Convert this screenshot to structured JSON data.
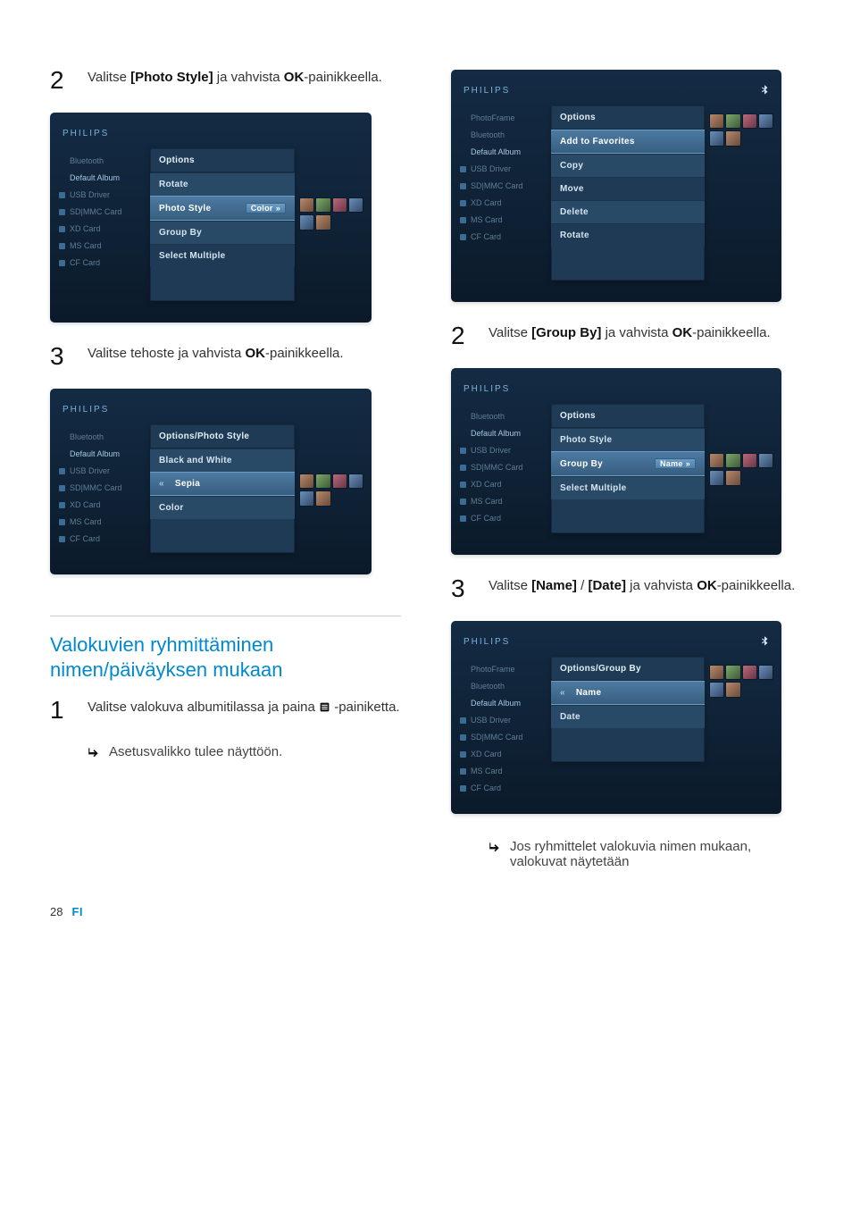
{
  "footer": {
    "page_number": "28",
    "locale": "FI"
  },
  "heading": "Valokuvien ryhmittäminen nimen/päiväyksen mukaan",
  "left": {
    "step2_a": "Valitse ",
    "step2_b": "[Photo Style]",
    "step2_c": " ja vahvista ",
    "step2_d": "OK",
    "step2_e": "-painikkeella.",
    "step3_a": "Valitse tehoste ja vahvista ",
    "step3_b": "OK",
    "step3_c": "-painikkeella.",
    "step1_a": "Valitse valokuva albumitilassa ja paina ",
    "step1_b": " -painiketta.",
    "bullet1": "Asetusvalikko tulee näyttöön."
  },
  "right": {
    "step2_a": "Valitse ",
    "step2_b": "[Group By]",
    "step2_c": " ja vahvista ",
    "step2_d": "OK",
    "step2_e": "-painikkeella.",
    "step3_a": "Valitse ",
    "step3_b": "[Name]",
    "step3_c": " / ",
    "step3_d": "[Date]",
    "step3_e": " ja vahvista ",
    "step3_f": "OK",
    "step3_g": "-painikkeella.",
    "bullet1": "Jos ryhmittelet valokuvia nimen mukaan, valokuvat näytetään"
  },
  "ss_common": {
    "logo": "PHILIPS",
    "sidebar": [
      "PhotoFrame",
      "Bluetooth",
      "Default Album",
      "USB Driver",
      "SD|MMC Card",
      "XD Card",
      "MS Card",
      "CF Card"
    ]
  },
  "ss1_left": {
    "title": "Options",
    "rows": [
      "Rotate",
      "Photo Style",
      "Group By",
      "Select Multiple"
    ],
    "hi_index": 1,
    "tag": "Color"
  },
  "ss2_left": {
    "title": "Options/Photo Style",
    "rows": [
      "Black and White",
      "Sepia",
      "Color"
    ],
    "hi_index": 1
  },
  "ss1_right": {
    "title": "Options",
    "rows": [
      "Add to Favorites",
      "Copy",
      "Move",
      "Delete",
      "Rotate"
    ],
    "hi_index": 0
  },
  "ss2_right": {
    "title": "Options",
    "rows": [
      "Photo Style",
      "Group By",
      "Select Multiple"
    ],
    "hi_index": 1,
    "tag": "Name"
  },
  "ss3_right": {
    "title": "Options/Group By",
    "rows": [
      "Name",
      "Date"
    ],
    "hi_index": 0
  }
}
